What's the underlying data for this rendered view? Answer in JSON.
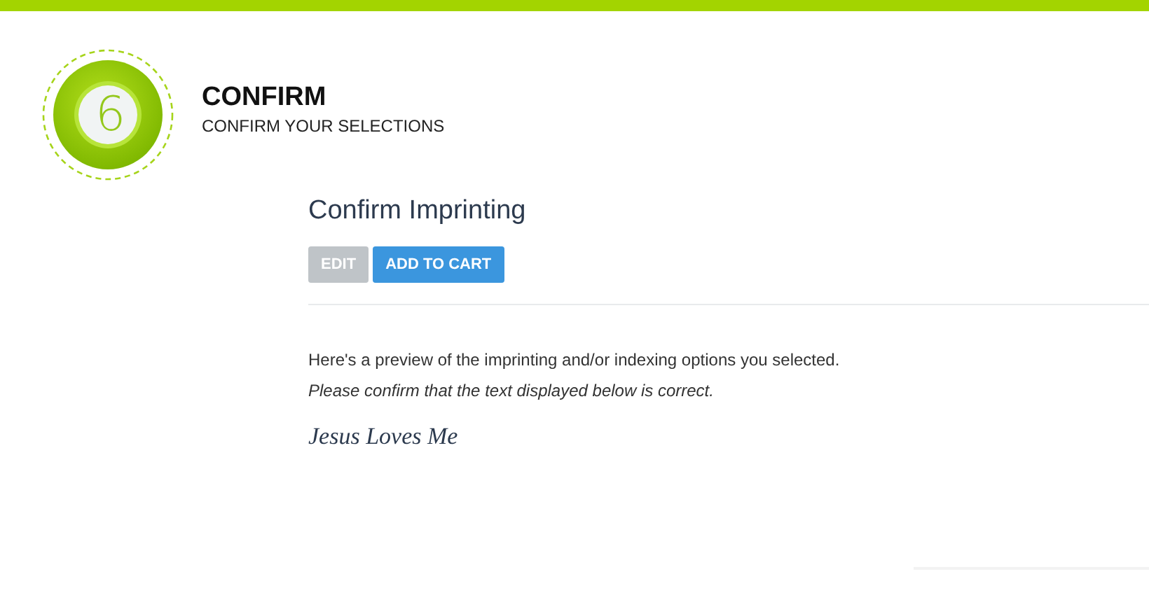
{
  "step": {
    "number": "6",
    "title": "CONFIRM",
    "subtitle": "CONFIRM YOUR SELECTIONS"
  },
  "section": {
    "title": "Confirm Imprinting",
    "buttons": [
      {
        "label": "EDIT",
        "disabled": true
      },
      {
        "label": "ADD TO CART",
        "disabled": false
      }
    ],
    "intro": "Here's a preview of the imprinting and/or indexing options you selected.",
    "note": "Please confirm that the text displayed below is correct.",
    "imprint": "Jesus Loves Me"
  }
}
